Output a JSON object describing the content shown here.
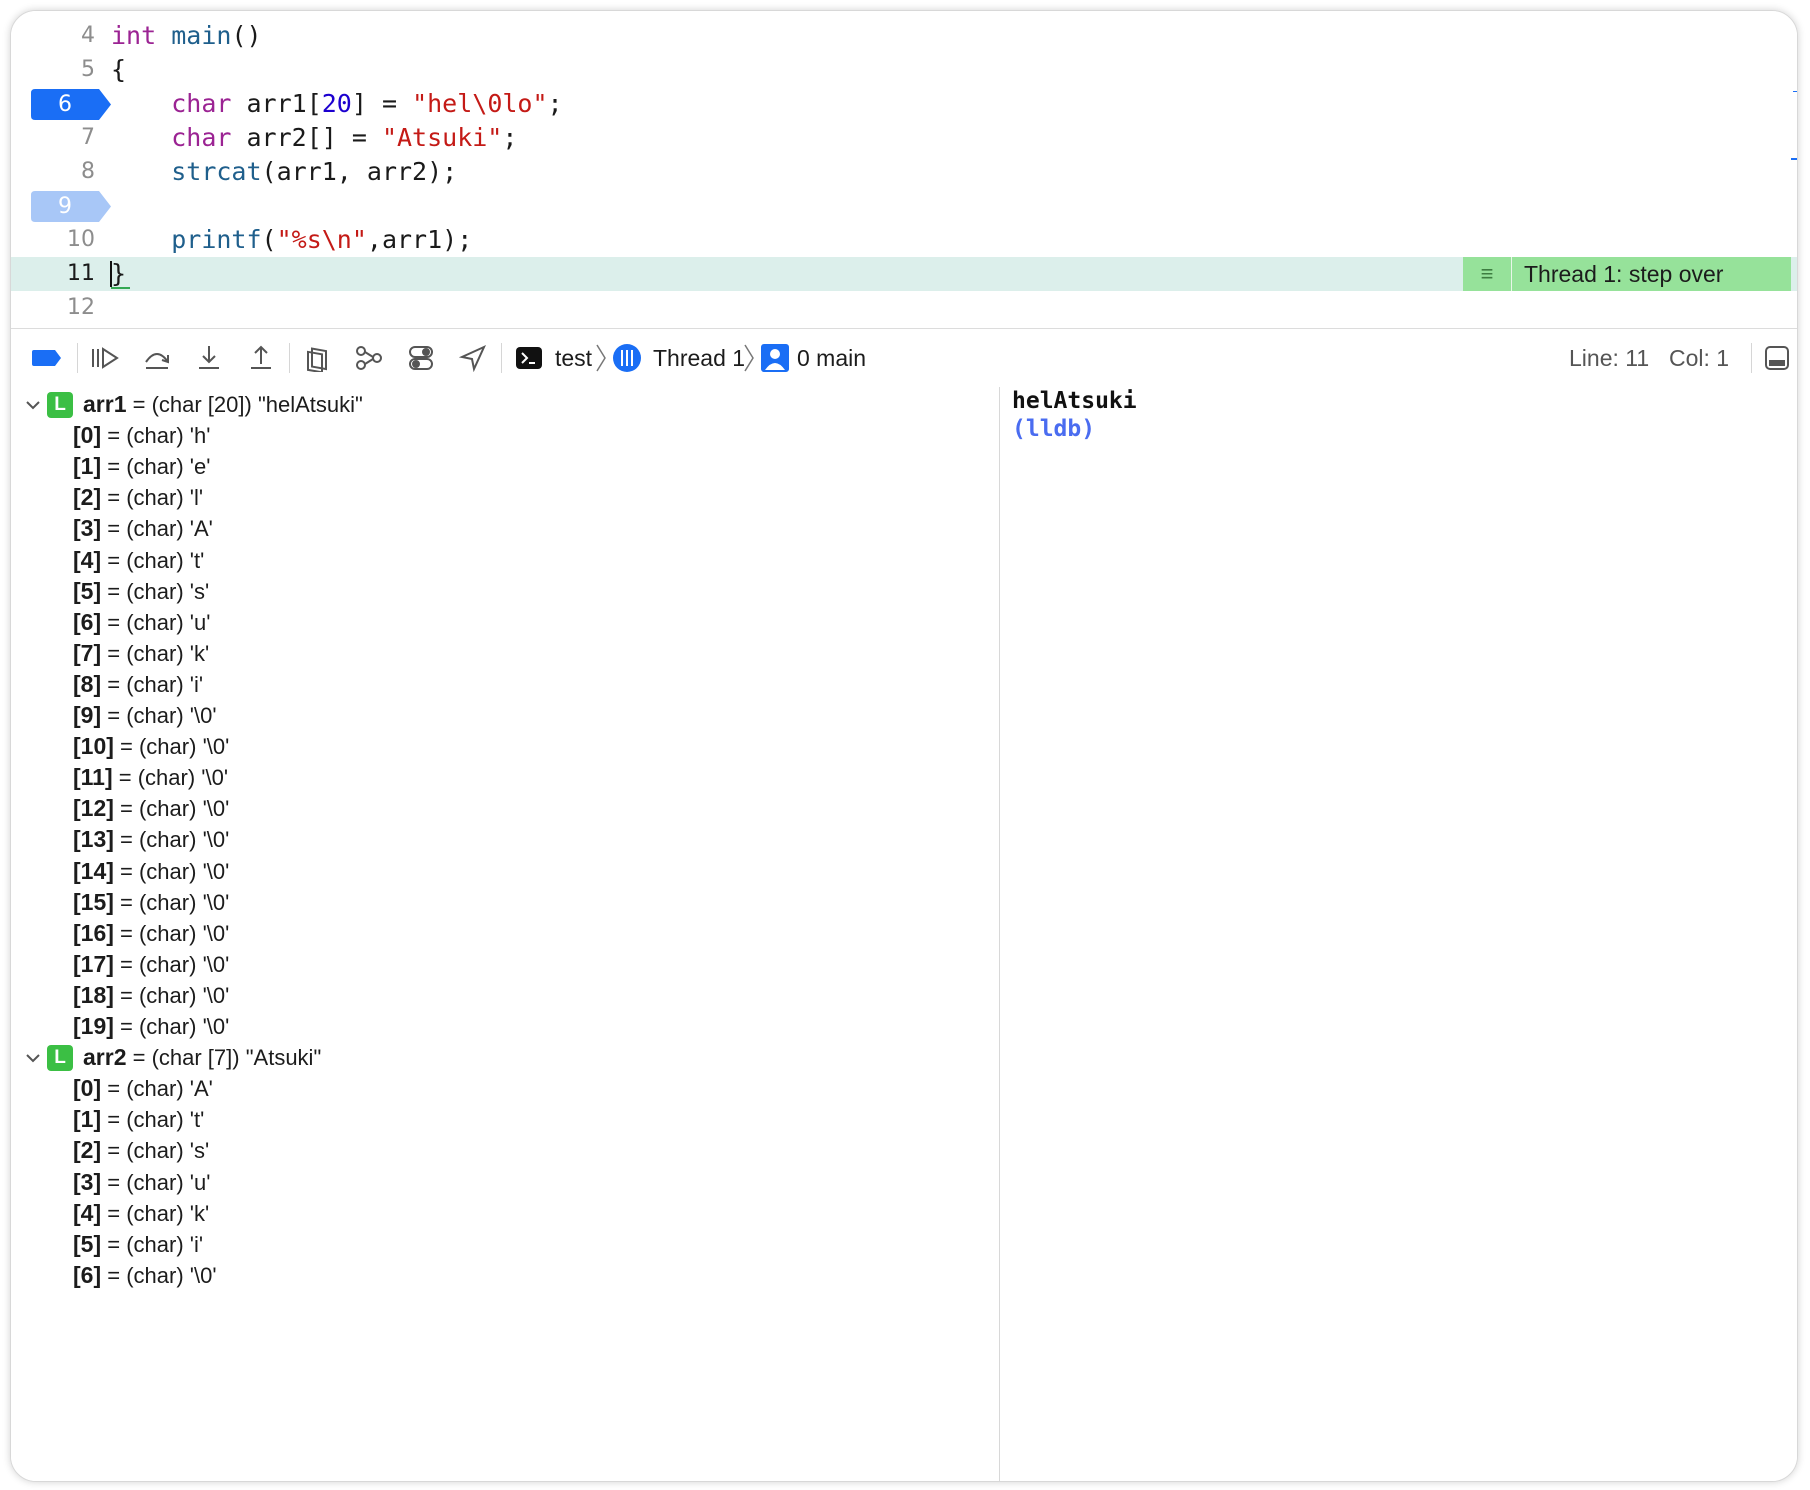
{
  "editor": {
    "lines": [
      {
        "num": "4",
        "segments": [
          {
            "t": "int",
            "c": "kw"
          },
          {
            "t": " ",
            "c": ""
          },
          {
            "t": "main",
            "c": "fn"
          },
          {
            "t": "()",
            "c": ""
          }
        ]
      },
      {
        "num": "5",
        "segments": [
          {
            "t": "{",
            "c": ""
          }
        ]
      },
      {
        "num": "6",
        "breakpoint": "active",
        "segments": [
          {
            "t": "    ",
            "c": ""
          },
          {
            "t": "char",
            "c": "kw"
          },
          {
            "t": " arr1[",
            "c": ""
          },
          {
            "t": "20",
            "c": "num"
          },
          {
            "t": "] = ",
            "c": ""
          },
          {
            "t": "\"hel\\0lo\"",
            "c": "str"
          },
          {
            "t": ";",
            "c": ""
          }
        ]
      },
      {
        "num": "7",
        "segments": [
          {
            "t": "    ",
            "c": ""
          },
          {
            "t": "char",
            "c": "kw"
          },
          {
            "t": " arr2[] = ",
            "c": ""
          },
          {
            "t": "\"Atsuki\"",
            "c": "str"
          },
          {
            "t": ";",
            "c": ""
          }
        ]
      },
      {
        "num": "8",
        "segments": [
          {
            "t": "    ",
            "c": ""
          },
          {
            "t": "strcat",
            "c": "fn"
          },
          {
            "t": "(arr1, arr2);",
            "c": ""
          }
        ]
      },
      {
        "num": "9",
        "breakpoint": "inactive",
        "segments": []
      },
      {
        "num": "10",
        "segments": [
          {
            "t": "    ",
            "c": ""
          },
          {
            "t": "printf",
            "c": "fn"
          },
          {
            "t": "(",
            "c": ""
          },
          {
            "t": "\"%s\\n\"",
            "c": "str"
          },
          {
            "t": ",arr1);",
            "c": ""
          }
        ]
      },
      {
        "num": "11",
        "current": true,
        "segments": [
          {
            "t": "}",
            "c": "cursor"
          }
        ]
      },
      {
        "num": "12",
        "segments": []
      }
    ],
    "thread_badge": "Thread 1: step over",
    "thread_badge_icon": "lines-icon"
  },
  "toolbar": {
    "icons": [
      "breakpoints-toggle-icon",
      "continue-icon",
      "step-over-icon",
      "step-into-icon",
      "step-out-icon",
      "view-hierarchy-icon",
      "memory-graph-icon",
      "environment-overrides-icon",
      "simulate-location-icon"
    ],
    "process": "test",
    "thread": "Thread 1",
    "frame": "0 main",
    "line_label": "Line: 11",
    "col_label": "Col: 1",
    "accent": "#1a6ef5"
  },
  "variables": [
    {
      "name": "arr1",
      "type": "(char [20])",
      "value": "\"helAtsuki\"",
      "badge": "L",
      "children": [
        {
          "idx": "[0]",
          "type": "(char)",
          "value": "'h'"
        },
        {
          "idx": "[1]",
          "type": "(char)",
          "value": "'e'"
        },
        {
          "idx": "[2]",
          "type": "(char)",
          "value": "'l'"
        },
        {
          "idx": "[3]",
          "type": "(char)",
          "value": "'A'"
        },
        {
          "idx": "[4]",
          "type": "(char)",
          "value": "'t'"
        },
        {
          "idx": "[5]",
          "type": "(char)",
          "value": "'s'"
        },
        {
          "idx": "[6]",
          "type": "(char)",
          "value": "'u'"
        },
        {
          "idx": "[7]",
          "type": "(char)",
          "value": "'k'"
        },
        {
          "idx": "[8]",
          "type": "(char)",
          "value": "'i'"
        },
        {
          "idx": "[9]",
          "type": "(char)",
          "value": "'\\0'"
        },
        {
          "idx": "[10]",
          "type": "(char)",
          "value": "'\\0'"
        },
        {
          "idx": "[11]",
          "type": "(char)",
          "value": "'\\0'"
        },
        {
          "idx": "[12]",
          "type": "(char)",
          "value": "'\\0'"
        },
        {
          "idx": "[13]",
          "type": "(char)",
          "value": "'\\0'"
        },
        {
          "idx": "[14]",
          "type": "(char)",
          "value": "'\\0'"
        },
        {
          "idx": "[15]",
          "type": "(char)",
          "value": "'\\0'"
        },
        {
          "idx": "[16]",
          "type": "(char)",
          "value": "'\\0'"
        },
        {
          "idx": "[17]",
          "type": "(char)",
          "value": "'\\0'"
        },
        {
          "idx": "[18]",
          "type": "(char)",
          "value": "'\\0'"
        },
        {
          "idx": "[19]",
          "type": "(char)",
          "value": "'\\0'"
        }
      ]
    },
    {
      "name": "arr2",
      "type": "(char [7])",
      "value": "\"Atsuki\"",
      "badge": "L",
      "children": [
        {
          "idx": "[0]",
          "type": "(char)",
          "value": "'A'"
        },
        {
          "idx": "[1]",
          "type": "(char)",
          "value": "'t'"
        },
        {
          "idx": "[2]",
          "type": "(char)",
          "value": "'s'"
        },
        {
          "idx": "[3]",
          "type": "(char)",
          "value": "'u'"
        },
        {
          "idx": "[4]",
          "type": "(char)",
          "value": "'k'"
        },
        {
          "idx": "[5]",
          "type": "(char)",
          "value": "'i'"
        },
        {
          "idx": "[6]",
          "type": "(char)",
          "value": "'\\0'"
        }
      ]
    }
  ],
  "console": {
    "output": "helAtsuki",
    "prompt": "(lldb)",
    "prompt_color": "#4a6cf0"
  }
}
